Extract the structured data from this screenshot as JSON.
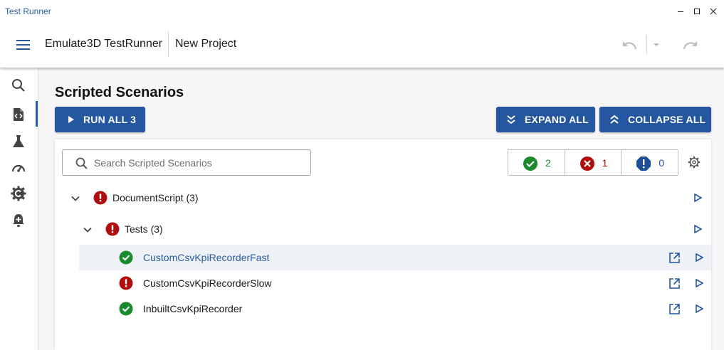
{
  "window": {
    "title": "Test Runner"
  },
  "appbar": {
    "app_name": "Emulate3D TestRunner",
    "project_name": "New Project"
  },
  "sidebar": {
    "items": [
      {
        "icon": "search-icon"
      },
      {
        "icon": "script-icon",
        "active": true
      },
      {
        "icon": "flask-icon"
      },
      {
        "icon": "speedometer-icon"
      },
      {
        "icon": "gear-badge-icon"
      },
      {
        "icon": "alert-bell-icon"
      }
    ]
  },
  "main": {
    "title": "Scripted Scenarios",
    "run_all_label": "RUN ALL 3",
    "expand_all_label": "EXPAND ALL",
    "collapse_all_label": "COLLAPSE ALL",
    "search": {
      "placeholder": "Search Scripted Scenarios",
      "value": ""
    },
    "counts": {
      "passed": "2",
      "failed": "1",
      "warning": "0"
    },
    "colors": {
      "pass": "#1a8a2e",
      "fail": "#b00e0e",
      "warning": "#1d4f99",
      "primary": "#2457a0",
      "link": "#2a5d9f"
    },
    "tree": {
      "root": {
        "label": "DocumentScript (3)",
        "status": "error",
        "expanded": true
      },
      "group": {
        "label": "Tests (3)",
        "status": "error",
        "expanded": true
      },
      "items": [
        {
          "label": "CustomCsvKpiRecorderFast",
          "status": "pass",
          "highlighted": true
        },
        {
          "label": "CustomCsvKpiRecorderSlow",
          "status": "error",
          "highlighted": false
        },
        {
          "label": "InbuiltCsvKpiRecorder",
          "status": "pass",
          "highlighted": false
        }
      ]
    }
  }
}
